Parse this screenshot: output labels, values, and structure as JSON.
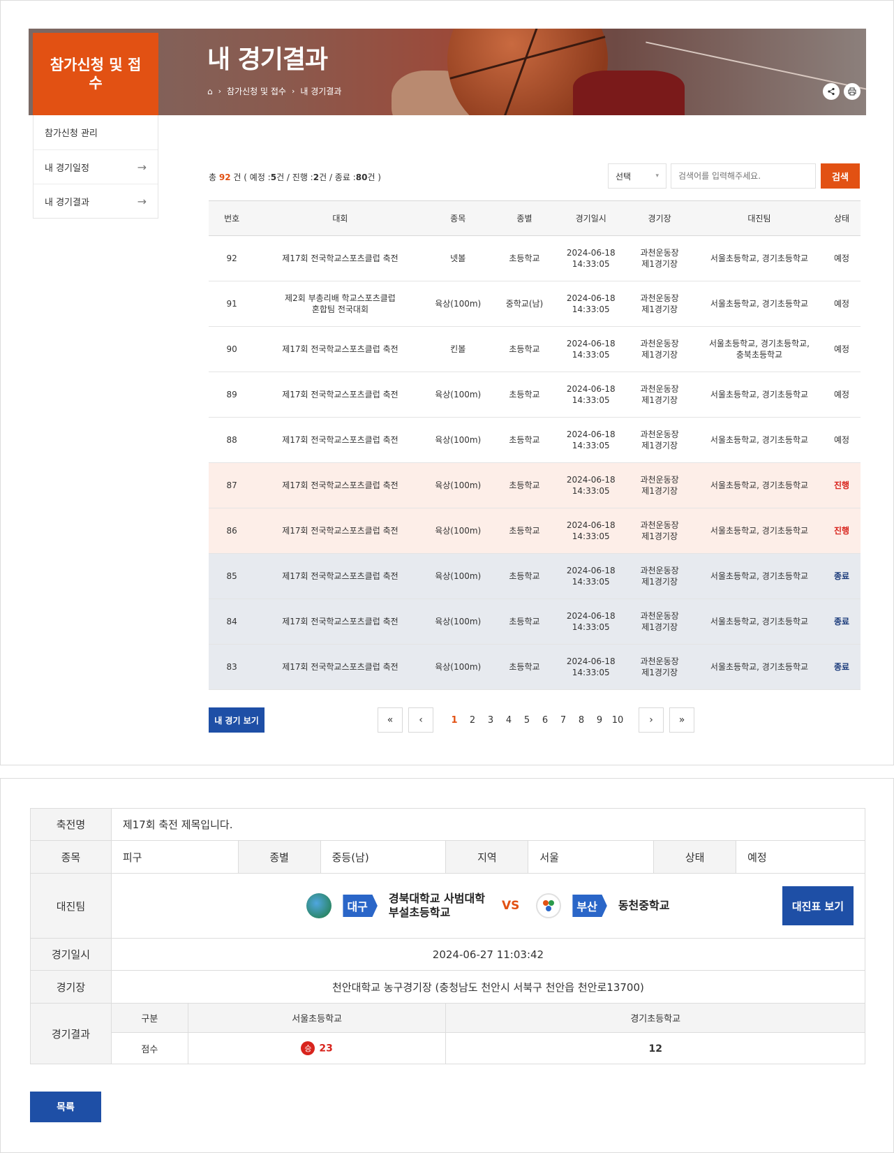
{
  "sidebar": {
    "title": "참가신청 및 접수",
    "items": [
      {
        "label": "참가신청 관리"
      },
      {
        "label": "내 경기일정"
      },
      {
        "label": "내 경기결과"
      }
    ]
  },
  "header": {
    "title": "내 경기결과",
    "breadcrumb": [
      "참가신청 및 접수",
      "내 경기결과"
    ]
  },
  "summary": {
    "prefix": "총",
    "total": "92",
    "unit": "건",
    "open_paren": "( 예정 :",
    "scheduled": "5",
    "progress_label": "건 / 진행 :",
    "progress": "2",
    "done_label": "건 / 종료 :",
    "done": "80",
    "close": "건 )"
  },
  "search": {
    "select_value": "선택",
    "placeholder": "검색어를 입력해주세요.",
    "button": "검색"
  },
  "table": {
    "headers": [
      "번호",
      "대회",
      "종목",
      "종별",
      "경기일시",
      "경기장",
      "대진팀",
      "상태"
    ],
    "rows": [
      {
        "no": "92",
        "comp": "제17회 전국학교스포츠클럽 축전",
        "comp2": "",
        "event": "넷볼",
        "cat": "초등학교",
        "date": "2024-06-18",
        "time": "14:33:05",
        "venue": "과천운동장",
        "venue2": "제1경기장",
        "teams": "서울초등학교, 경기초등학교",
        "teams2": "",
        "status": "예정",
        "state": "scheduled"
      },
      {
        "no": "91",
        "comp": "제2회 부총리배 학교스포츠클럽",
        "comp2": "혼합팀 전국대회",
        "event": "육상(100m)",
        "cat": "중학교(남)",
        "date": "2024-06-18",
        "time": "14:33:05",
        "venue": "과천운동장",
        "venue2": "제1경기장",
        "teams": "서울초등학교, 경기초등학교",
        "teams2": "",
        "status": "예정",
        "state": "scheduled"
      },
      {
        "no": "90",
        "comp": "제17회 전국학교스포츠클럽 축전",
        "comp2": "",
        "event": "킨볼",
        "cat": "초등학교",
        "date": "2024-06-18",
        "time": "14:33:05",
        "venue": "과천운동장",
        "venue2": "제1경기장",
        "teams": "서울초등학교, 경기초등학교,",
        "teams2": "충북초등학교",
        "status": "예정",
        "state": "scheduled"
      },
      {
        "no": "89",
        "comp": "제17회 전국학교스포츠클럽 축전",
        "comp2": "",
        "event": "육상(100m)",
        "cat": "초등학교",
        "date": "2024-06-18",
        "time": "14:33:05",
        "venue": "과천운동장",
        "venue2": "제1경기장",
        "teams": "서울초등학교, 경기초등학교",
        "teams2": "",
        "status": "예정",
        "state": "scheduled"
      },
      {
        "no": "88",
        "comp": "제17회 전국학교스포츠클럽 축전",
        "comp2": "",
        "event": "육상(100m)",
        "cat": "초등학교",
        "date": "2024-06-18",
        "time": "14:33:05",
        "venue": "과천운동장",
        "venue2": "제1경기장",
        "teams": "서울초등학교, 경기초등학교",
        "teams2": "",
        "status": "예정",
        "state": "scheduled"
      },
      {
        "no": "87",
        "comp": "제17회 전국학교스포츠클럽 축전",
        "comp2": "",
        "event": "육상(100m)",
        "cat": "초등학교",
        "date": "2024-06-18",
        "time": "14:33:05",
        "venue": "과천운동장",
        "venue2": "제1경기장",
        "teams": "서울초등학교, 경기초등학교",
        "teams2": "",
        "status": "진행",
        "state": "progress"
      },
      {
        "no": "86",
        "comp": "제17회 전국학교스포츠클럽 축전",
        "comp2": "",
        "event": "육상(100m)",
        "cat": "초등학교",
        "date": "2024-06-18",
        "time": "14:33:05",
        "venue": "과천운동장",
        "venue2": "제1경기장",
        "teams": "서울초등학교, 경기초등학교",
        "teams2": "",
        "status": "진행",
        "state": "progress"
      },
      {
        "no": "85",
        "comp": "제17회 전국학교스포츠클럽 축전",
        "comp2": "",
        "event": "육상(100m)",
        "cat": "초등학교",
        "date": "2024-06-18",
        "time": "14:33:05",
        "venue": "과천운동장",
        "venue2": "제1경기장",
        "teams": "서울초등학교, 경기초등학교",
        "teams2": "",
        "status": "종료",
        "state": "done"
      },
      {
        "no": "84",
        "comp": "제17회 전국학교스포츠클럽 축전",
        "comp2": "",
        "event": "육상(100m)",
        "cat": "초등학교",
        "date": "2024-06-18",
        "time": "14:33:05",
        "venue": "과천운동장",
        "venue2": "제1경기장",
        "teams": "서울초등학교, 경기초등학교",
        "teams2": "",
        "status": "종료",
        "state": "done"
      },
      {
        "no": "83",
        "comp": "제17회 전국학교스포츠클럽 축전",
        "comp2": "",
        "event": "육상(100m)",
        "cat": "초등학교",
        "date": "2024-06-18",
        "time": "14:33:05",
        "venue": "과천운동장",
        "venue2": "제1경기장",
        "teams": "서울초등학교, 경기초등학교",
        "teams2": "",
        "status": "종료",
        "state": "done"
      }
    ]
  },
  "my_games_button": "내 경기 보기",
  "pagination": {
    "first": "«",
    "prev": "‹",
    "next": "›",
    "last": "»",
    "pages": [
      "1",
      "2",
      "3",
      "4",
      "5",
      "6",
      "7",
      "8",
      "9",
      "10"
    ],
    "active": "1"
  },
  "detail": {
    "festival_label": "축전명",
    "festival_value": "제17회 축전 제목입니다.",
    "event_label": "종목",
    "event_value": "피구",
    "category_label": "종별",
    "category_value": "중등(남)",
    "region_label": "지역",
    "region_value": "서울",
    "status_label": "상태",
    "status_value": "예정",
    "teams_label": "대진팀",
    "team1_region": "대구",
    "team1_name_line1": "경북대학교 사범대학",
    "team1_name_line2": "부설초등학교",
    "vs": "VS",
    "team2_region": "부산",
    "team2_name": "동천중학교",
    "bracket_button": "대진표 보기",
    "datetime_label": "경기일시",
    "datetime_value": "2024-06-27 11:03:42",
    "venue_label": "경기장",
    "venue_value": "천안대학교 농구경기장 (충청남도 천안시 서북구 천안읍 천안로13700)",
    "result_label": "경기결과",
    "result_col_label": "구분",
    "result_team1": "서울초등학교",
    "result_team2": "경기초등학교",
    "score_label": "점수",
    "win_badge": "승",
    "score1": "23",
    "score2": "12"
  },
  "list_button": "목록",
  "colors": {
    "accent_orange": "#e25113",
    "primary_blue": "#1e4fa6",
    "progress_red": "#d8241d",
    "done_navy": "#1a3a7a"
  }
}
